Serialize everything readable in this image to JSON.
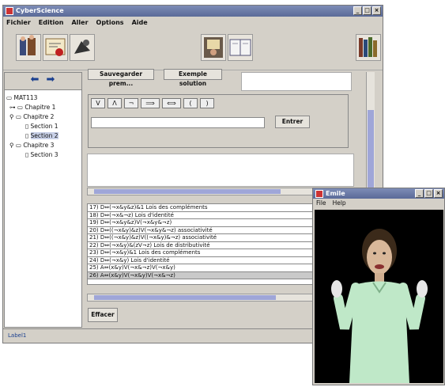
{
  "main_window": {
    "title": "CyberScience",
    "controls": [
      "_",
      "□",
      "×"
    ]
  },
  "menu": [
    "Fichier",
    "Edition",
    "Aller",
    "Options",
    "Aide"
  ],
  "toolbar": {
    "icons": [
      "people-icon",
      "certificate-icon",
      "puppet-icon",
      "teacher-icon",
      "book-icon",
      "library-icon"
    ]
  },
  "nav": {
    "back": "⬅",
    "forward": "➡"
  },
  "tree": [
    {
      "label": "MAT113",
      "level": 0,
      "icon": "folder-icon"
    },
    {
      "label": "Chapitre 1",
      "level": 1,
      "icon": "folder-icon"
    },
    {
      "label": "Chapitre 2",
      "level": 1,
      "icon": "folder-icon"
    },
    {
      "label": "Section 1",
      "level": 2,
      "icon": "page-icon"
    },
    {
      "label": "Section 2",
      "level": 2,
      "icon": "page-icon",
      "selected": true
    },
    {
      "label": "Chapitre 3",
      "level": 1,
      "icon": "folder-icon"
    },
    {
      "label": "Section 3",
      "level": 2,
      "icon": "page-icon"
    }
  ],
  "buttons": {
    "save": "Sauvegarder prem...",
    "example": "Exemple solution",
    "enter": "Entrer",
    "clear": "Effacer"
  },
  "operators": [
    "V",
    "Λ",
    "¬",
    "⟹",
    "⟺",
    "(",
    ")"
  ],
  "proof_lines": [
    "17) D⇔(¬x&y&z)&1   Lois des compléments",
    "18) D⇔(¬x&¬z)   Lois d'identité",
    "19) D⇔(¬x&y&z)V(¬x&y&¬z)",
    "20) D⇔((¬x&y)&z)V(¬x&y&¬z)   associativité",
    "21) D⇔((¬x&y)&z)V((¬x&y)&¬z)   associativité",
    "22) D⇔(¬x&y)&(zV¬z)   Lois de distributivité",
    "23) D⇔(¬x&y)&1   Lois des compléments",
    "24) D⇔(¬x&y)   Lois d'identité",
    "25) A⇔(x&y)V(¬x&¬z)V(¬x&y)",
    "26) A⇔(x&y)V(¬x&y)V(¬x&¬z)"
  ],
  "status": "Label1",
  "emile_window": {
    "title": "Emile",
    "controls": [
      "_",
      "□",
      "×"
    ],
    "menu": [
      "File",
      "Help"
    ]
  },
  "colors": {
    "titlebar": "#5a6a98",
    "window_bg": "#d4d0c8",
    "scroll_thumb": "#9fa6d8",
    "agent_bg": "#000000",
    "agent_shirt": "#bfe8c8"
  }
}
